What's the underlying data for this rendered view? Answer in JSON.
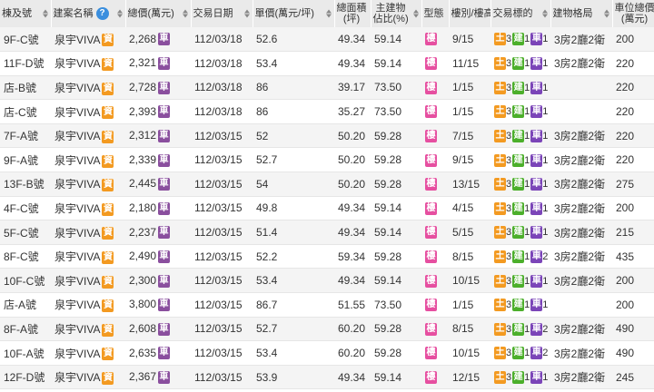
{
  "headers": {
    "unit": "棟及號",
    "project": "建案名稱",
    "help": "?",
    "total_price": "總價(萬元)",
    "date": "交易日期",
    "unit_price": "單價(萬元/坪)",
    "area_l1": "總面積",
    "area_l2": "(坪)",
    "main_l1": "主建物",
    "main_l2": "佔比(%)",
    "type": "型態",
    "floor": "樓別/樓高",
    "target": "交易標的",
    "layout": "建物格局",
    "parking_l1": "車位總價",
    "parking_l2": "(萬元)"
  },
  "badges": {
    "capital": "資",
    "car": "車",
    "building": "樓",
    "land": "土",
    "build": "建",
    "park": "車"
  },
  "colors": {
    "capital": "#f39a21",
    "car": "#8a4f9e",
    "building": "#e64fa0",
    "land": "#f39a21",
    "build": "#4caf2b",
    "park": "#7b45b8"
  },
  "rows": [
    {
      "unit": "9F-C號",
      "project": "泉宇VIVA",
      "price": "2,268",
      "car": true,
      "date": "112/03/18",
      "unit_price": "52.6",
      "area": "49.34",
      "main": "59.14",
      "floor": "9/15",
      "land": "3",
      "build": "1",
      "park": "1",
      "layout": "3房2廳2衛",
      "parking": "200"
    },
    {
      "unit": "11F-D號",
      "project": "泉宇VIVA",
      "price": "2,321",
      "car": true,
      "date": "112/03/18",
      "unit_price": "53.4",
      "area": "49.34",
      "main": "59.14",
      "floor": "11/15",
      "land": "3",
      "build": "1",
      "park": "1",
      "layout": "3房2廳2衛",
      "parking": "220"
    },
    {
      "unit": "店-B號",
      "project": "泉宇VIVA",
      "price": "2,728",
      "car": true,
      "date": "112/03/18",
      "unit_price": "86",
      "area": "39.17",
      "main": "73.50",
      "floor": "1/15",
      "land": "3",
      "build": "1",
      "park": "1",
      "layout": "",
      "parking": "220"
    },
    {
      "unit": "店-C號",
      "project": "泉宇VIVA",
      "price": "2,393",
      "car": true,
      "date": "112/03/18",
      "unit_price": "86",
      "area": "35.27",
      "main": "73.50",
      "floor": "1/15",
      "land": "3",
      "build": "1",
      "park": "1",
      "layout": "",
      "parking": "220"
    },
    {
      "unit": "7F-A號",
      "project": "泉宇VIVA",
      "price": "2,312",
      "car": true,
      "date": "112/03/15",
      "unit_price": "52",
      "area": "50.20",
      "main": "59.28",
      "floor": "7/15",
      "land": "3",
      "build": "1",
      "park": "1",
      "layout": "3房2廳2衛",
      "parking": "220"
    },
    {
      "unit": "9F-A號",
      "project": "泉宇VIVA",
      "price": "2,339",
      "car": true,
      "date": "112/03/15",
      "unit_price": "52.7",
      "area": "50.20",
      "main": "59.28",
      "floor": "9/15",
      "land": "3",
      "build": "1",
      "park": "1",
      "layout": "3房2廳2衛",
      "parking": "220"
    },
    {
      "unit": "13F-B號",
      "project": "泉宇VIVA",
      "price": "2,445",
      "car": true,
      "date": "112/03/15",
      "unit_price": "54",
      "area": "50.20",
      "main": "59.28",
      "floor": "13/15",
      "land": "3",
      "build": "1",
      "park": "1",
      "layout": "3房2廳2衛",
      "parking": "275"
    },
    {
      "unit": "4F-C號",
      "project": "泉宇VIVA",
      "price": "2,180",
      "car": true,
      "date": "112/03/15",
      "unit_price": "49.8",
      "area": "49.34",
      "main": "59.14",
      "floor": "4/15",
      "land": "3",
      "build": "1",
      "park": "1",
      "layout": "3房2廳2衛",
      "parking": "200"
    },
    {
      "unit": "5F-C號",
      "project": "泉宇VIVA",
      "price": "2,237",
      "car": true,
      "date": "112/03/15",
      "unit_price": "51.4",
      "area": "49.34",
      "main": "59.14",
      "floor": "5/15",
      "land": "3",
      "build": "1",
      "park": "1",
      "layout": "3房2廳2衛",
      "parking": "215"
    },
    {
      "unit": "8F-C號",
      "project": "泉宇VIVA",
      "price": "2,490",
      "car": true,
      "date": "112/03/15",
      "unit_price": "52.2",
      "area": "59.34",
      "main": "59.28",
      "floor": "8/15",
      "land": "3",
      "build": "1",
      "park": "2",
      "layout": "3房2廳2衛",
      "parking": "435"
    },
    {
      "unit": "10F-C號",
      "project": "泉宇VIVA",
      "price": "2,300",
      "car": true,
      "date": "112/03/15",
      "unit_price": "53.4",
      "area": "49.34",
      "main": "59.14",
      "floor": "10/15",
      "land": "3",
      "build": "1",
      "park": "1",
      "layout": "3房2廳2衛",
      "parking": "200"
    },
    {
      "unit": "店-A號",
      "project": "泉宇VIVA",
      "price": "3,800",
      "car": true,
      "date": "112/03/15",
      "unit_price": "86.7",
      "area": "51.55",
      "main": "73.50",
      "floor": "1/15",
      "land": "3",
      "build": "1",
      "park": "1",
      "layout": "",
      "parking": "200"
    },
    {
      "unit": "8F-A號",
      "project": "泉宇VIVA",
      "price": "2,608",
      "car": true,
      "date": "112/03/15",
      "unit_price": "52.7",
      "area": "60.20",
      "main": "59.28",
      "floor": "8/15",
      "land": "3",
      "build": "1",
      "park": "2",
      "layout": "3房2廳2衛",
      "parking": "490"
    },
    {
      "unit": "10F-A號",
      "project": "泉宇VIVA",
      "price": "2,635",
      "car": true,
      "date": "112/03/15",
      "unit_price": "53.4",
      "area": "60.20",
      "main": "59.28",
      "floor": "10/15",
      "land": "3",
      "build": "1",
      "park": "2",
      "layout": "3房2廳2衛",
      "parking": "490"
    },
    {
      "unit": "12F-D號",
      "project": "泉宇VIVA",
      "price": "2,367",
      "car": true,
      "date": "112/03/15",
      "unit_price": "53.9",
      "area": "49.34",
      "main": "59.14",
      "floor": "12/15",
      "land": "3",
      "build": "1",
      "park": "1",
      "layout": "3房2廳2衛",
      "parking": "245"
    }
  ]
}
